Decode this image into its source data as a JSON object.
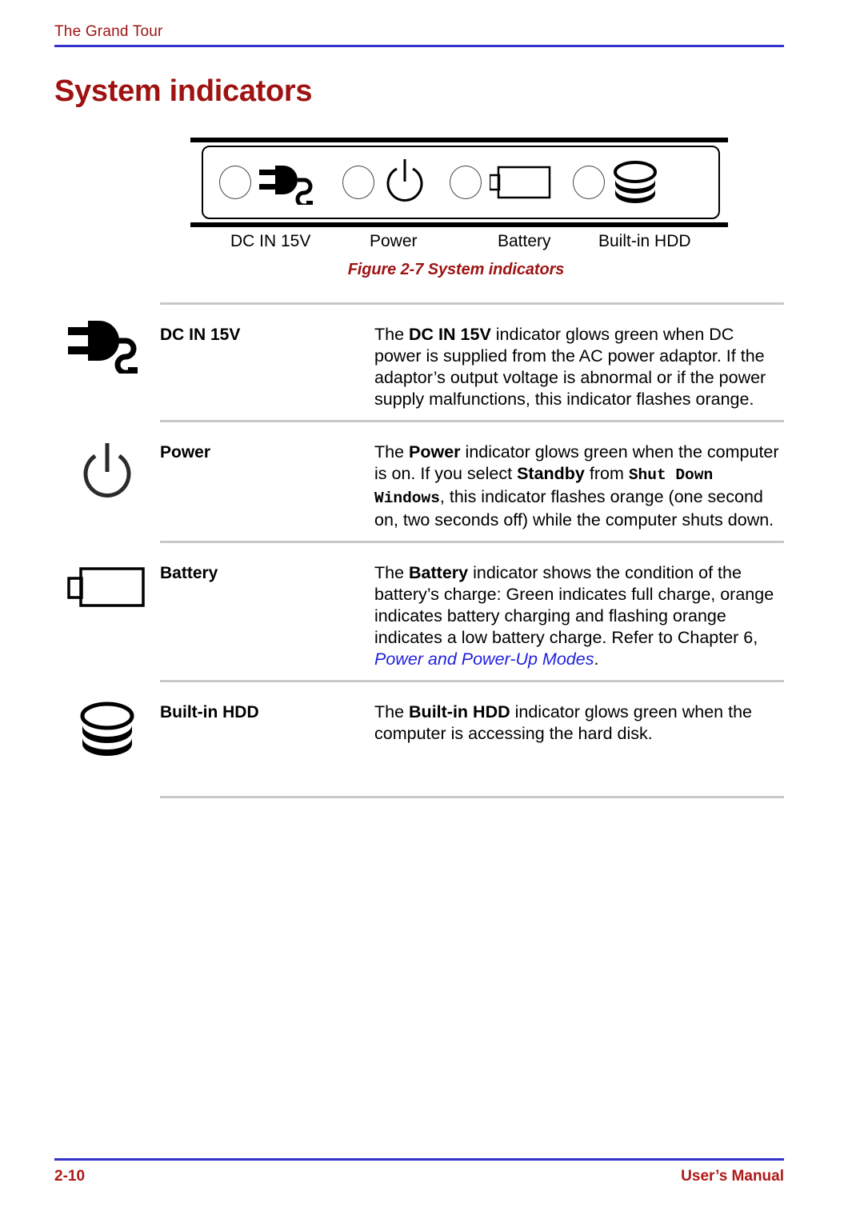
{
  "header": {
    "running_title": "The Grand Tour",
    "rule_color": "#3333cc",
    "title_color": "#9e1212"
  },
  "heading": {
    "text": "System indicators"
  },
  "figure": {
    "caption": "Figure 2-7 System indicators",
    "caption_color": "#9e1212",
    "indicators": [
      {
        "label": "DC IN 15V",
        "icon": "power-plug-icon"
      },
      {
        "label": "Power",
        "icon": "power-symbol-icon"
      },
      {
        "label": "Battery",
        "icon": "battery-icon"
      },
      {
        "label": "Built-in HDD",
        "icon": "hard-disk-icon"
      }
    ]
  },
  "table": {
    "rows": [
      {
        "icon": "power-plug-icon",
        "name": "DC IN 15V",
        "desc_prefix": "The ",
        "desc_bold": "DC IN 15V",
        "desc_rest": " indicator glows green when DC power is supplied from the AC power adaptor. If the adaptor’s output voltage is abnormal or if the power supply malfunctions, this indicator flashes orange."
      },
      {
        "icon": "power-symbol-icon",
        "name": "Power",
        "desc_prefix": "The ",
        "desc_bold": "Power",
        "desc_mid": " indicator glows green when the computer is on. If you select ",
        "desc_bold2": "Standby",
        "desc_mid2": " from ",
        "desc_mono": "Shut Down Windows",
        "desc_rest": ", this indicator flashes orange (one second on, two seconds off) while the computer shuts down."
      },
      {
        "icon": "battery-icon",
        "name": "Battery",
        "desc_prefix": "The ",
        "desc_bold": "Battery",
        "desc_mid": " indicator shows the condition of the battery’s charge: Green indicates full charge, orange indicates battery charging and flashing orange indicates a low battery charge. Refer to Chapter 6, ",
        "desc_xref": "Power and Power-Up Modes",
        "desc_rest": "."
      },
      {
        "icon": "hard-disk-icon",
        "name": "Built-in HDD",
        "desc_prefix": "The ",
        "desc_bold": "Built-in HDD",
        "desc_rest": " indicator glows green when the computer is accessing the hard disk."
      }
    ]
  },
  "footer": {
    "page_number": "2-10",
    "manual_label": "User’s Manual",
    "text_color": "#b01818",
    "rule_color": "#3333cc"
  }
}
